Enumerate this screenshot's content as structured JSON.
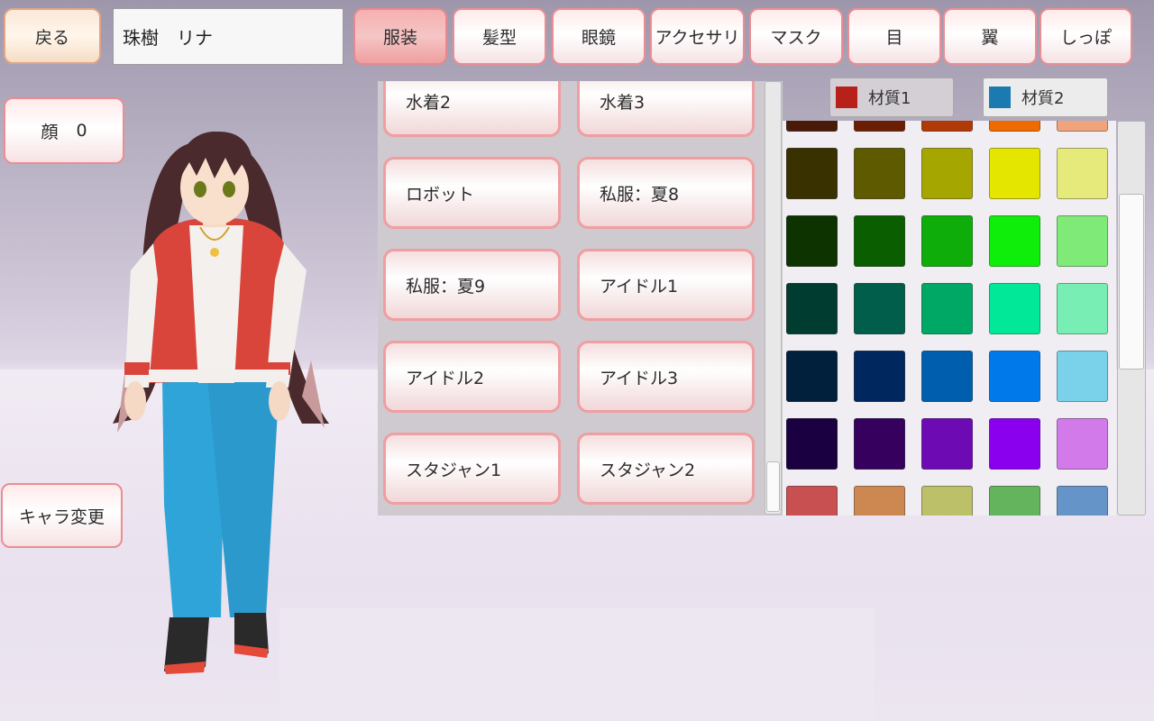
{
  "back_label": "戻る",
  "character_name": "珠樹　リナ",
  "tabs": [
    {
      "label": "服装",
      "active": true
    },
    {
      "label": "髪型",
      "active": false
    },
    {
      "label": "眼鏡",
      "active": false
    },
    {
      "label": "アクセサリ",
      "active": false
    },
    {
      "label": "マスク",
      "active": false
    },
    {
      "label": "目",
      "active": false
    },
    {
      "label": "翼",
      "active": false
    },
    {
      "label": "しっぽ",
      "active": false
    }
  ],
  "face": {
    "label": "顔",
    "value": "0"
  },
  "change_character_label": "キャラ変更",
  "outfits": [
    "水着2",
    "水着3",
    "ロボット",
    "私服：夏8",
    "私服：夏9",
    "アイドル1",
    "アイドル2",
    "アイドル3",
    "スタジャン1",
    "スタジャン2"
  ],
  "materials": [
    {
      "label": "材質1",
      "color": "#b8201a",
      "selected": true
    },
    {
      "label": "材質2",
      "color": "#1b7ab0",
      "selected": false
    }
  ],
  "palette": [
    [
      "#4a1a08",
      "#6a1f05",
      "#b03a06",
      "#f06a00",
      "#efa47c"
    ],
    [
      "#3a3100",
      "#5e5a00",
      "#a6a600",
      "#e4e600",
      "#e6ea7a"
    ],
    [
      "#0d3300",
      "#0b5e00",
      "#0fad0a",
      "#0fee0a",
      "#80ea78"
    ],
    [
      "#003d30",
      "#005e4b",
      "#00a866",
      "#00e898",
      "#78edb4"
    ],
    [
      "#00203b",
      "#00285e",
      "#005eae",
      "#007aea",
      "#7ad2ea"
    ],
    [
      "#1a0040",
      "#35005e",
      "#6e0ab4",
      "#8a00ee",
      "#d27aea"
    ],
    [
      "#c85050",
      "#cc8850",
      "#bcc068",
      "#64b45e",
      "#6494c8"
    ]
  ]
}
